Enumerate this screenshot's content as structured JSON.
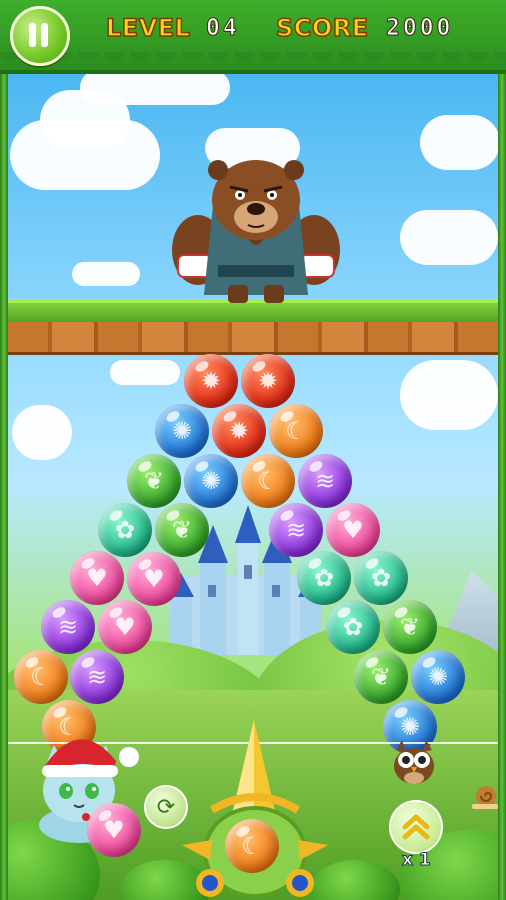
{
  "hud": {
    "level_label": "LEVEL",
    "level_value": "04",
    "score_label": "SCORE",
    "score_value": "2000"
  },
  "boost": {
    "count_label": "x 1"
  },
  "icons": {
    "pause": "pause-icon",
    "swap": "swap-icon",
    "boost": "double-chevron-up-icon",
    "bubble_leaf": "leaf-icon",
    "bubble_flame": "flame-icon",
    "bubble_swirl": "swirl-icon",
    "bubble_moon": "moon-star-icon",
    "bubble_heart": "heart-icon",
    "bubble_flower": "flower-icon",
    "bubble_wave": "wave-icon"
  },
  "colors": {
    "hud_label": "#ffd21c",
    "hud_value": "#ffffff",
    "frame_green": "#3fae2a"
  },
  "bubbles": [
    {
      "color": "red",
      "symbol": "flame"
    },
    {
      "color": "red",
      "symbol": "flame"
    },
    {
      "color": "blue",
      "symbol": "swirl"
    },
    {
      "color": "red",
      "symbol": "flame"
    },
    {
      "color": "orange",
      "symbol": "moon"
    },
    {
      "color": "green",
      "symbol": "leaf"
    },
    {
      "color": "blue",
      "symbol": "swirl"
    },
    {
      "color": "orange",
      "symbol": "moon"
    },
    {
      "color": "purple",
      "symbol": "wave"
    },
    {
      "color": "teal",
      "symbol": "flower"
    },
    {
      "color": "green",
      "symbol": "leaf"
    },
    {
      "color": "purple",
      "symbol": "wave"
    },
    {
      "color": "pink",
      "symbol": "heart"
    },
    {
      "color": "pink",
      "symbol": "heart"
    },
    {
      "color": "teal",
      "symbol": "flower"
    },
    {
      "color": "pink",
      "symbol": "heart"
    },
    {
      "color": "teal",
      "symbol": "flower"
    },
    {
      "color": "purple",
      "symbol": "wave"
    },
    {
      "color": "pink",
      "symbol": "heart"
    },
    {
      "color": "teal",
      "symbol": "flower"
    },
    {
      "color": "green",
      "symbol": "leaf"
    },
    {
      "color": "orange",
      "symbol": "moon"
    },
    {
      "color": "purple",
      "symbol": "wave"
    },
    {
      "color": "green",
      "symbol": "leaf"
    },
    {
      "color": "blue",
      "symbol": "swirl"
    },
    {
      "color": "orange",
      "symbol": "moon"
    },
    {
      "color": "blue",
      "symbol": "swirl"
    }
  ],
  "shooter": {
    "loaded": {
      "color": "orange",
      "symbol": "moon"
    },
    "next": {
      "color": "pink",
      "symbol": "heart"
    }
  }
}
